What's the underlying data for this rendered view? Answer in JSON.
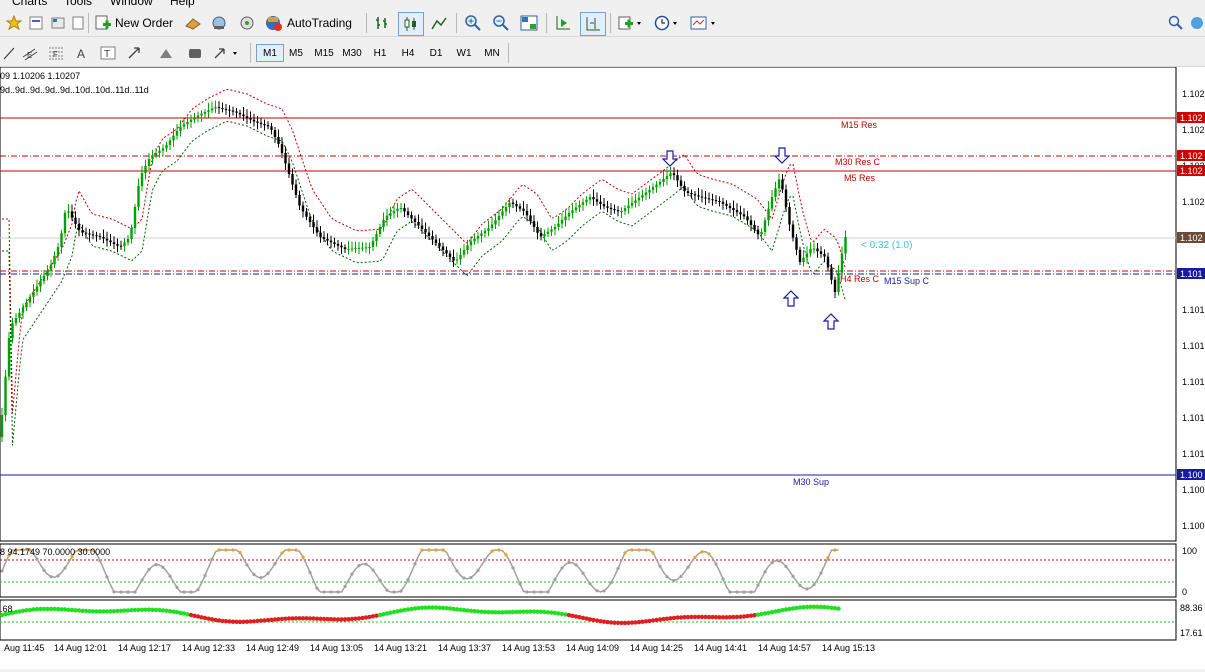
{
  "menu": {
    "items": [
      "Charts",
      "Tools",
      "Window",
      "Help"
    ]
  },
  "toolbar": {
    "new_order_label": "New Order",
    "autotrading_label": "AutoTrading",
    "timeframes": [
      "M1",
      "M5",
      "M15",
      "M30",
      "H1",
      "H4",
      "D1",
      "W1",
      "MN"
    ],
    "active_timeframe": "M1"
  },
  "chart": {
    "info_line1": "09 1.10206 1.10207",
    "info_line2": "9d..9d..9d..9d..9d..10d..10d..11d..11d",
    "price_ticks": [
      "1.102",
      "1.102",
      "1.102",
      "1.102",
      "1.102",
      "1.101",
      "1.101",
      "1.101",
      "1.101",
      "1.101",
      "1.101",
      "1.100",
      "1.100"
    ],
    "highlight_labels": [
      {
        "text": "1.102",
        "bg": "#d00000"
      },
      {
        "text": "1.102",
        "bg": "#d00000"
      },
      {
        "text": "1.102",
        "bg": "#d00000"
      },
      {
        "text": "1.102",
        "bg": "#6b4a3a"
      },
      {
        "text": "1.101",
        "bg": "#1a1aa0"
      },
      {
        "text": "1.100",
        "bg": "#1a1aa0"
      }
    ],
    "level_labels": {
      "m15_res": "M15 Res",
      "m30_res": "M30 Res C",
      "m5_res": "M5 Res",
      "h4_res": "H4 Res C",
      "m15_sup": "M15 Sup C",
      "m30_sup": "M30 Sup"
    },
    "countdown": "< 0:32 (1.0)",
    "colors": {
      "up": "#00a000",
      "down": "#000000",
      "res": "#c00000",
      "sup": "#1a1aa0",
      "arrow": "#1a1aa0",
      "countdown": "#40c0e0"
    }
  },
  "stoch": {
    "header": "8 94.1749 70.0000 30.0000",
    "axis_top": "100",
    "axis_bottom": "0"
  },
  "lower": {
    "header": ".68",
    "axis_top": "88.36",
    "axis_bottom": "17.61"
  },
  "time_axis": [
    "Aug 11:45",
    "14 Aug 12:01",
    "14 Aug 12:17",
    "14 Aug 12:33",
    "14 Aug 12:49",
    "14 Aug 13:05",
    "14 Aug 13:21",
    "14 Aug 13:37",
    "14 Aug 13:53",
    "14 Aug 14:09",
    "14 Aug 14:25",
    "14 Aug 14:41",
    "14 Aug 14:57",
    "14 Aug 15:13"
  ]
}
